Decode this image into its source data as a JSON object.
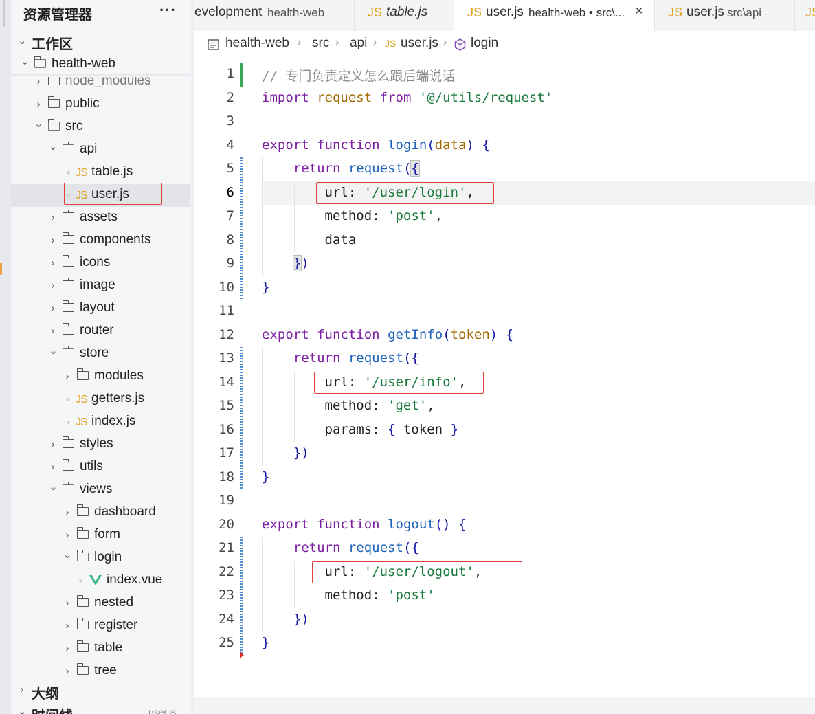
{
  "explorer": {
    "title": "资源管理器",
    "more": "···",
    "workspace_label": "工作区",
    "tree": [
      {
        "label": "health-web",
        "type": "folder-open",
        "depth": 0
      },
      {
        "label": "node_modules",
        "type": "folder",
        "depth": 1
      },
      {
        "label": "public",
        "type": "folder",
        "depth": 1
      },
      {
        "label": "src",
        "type": "folder-open",
        "depth": 1
      },
      {
        "label": "api",
        "type": "folder-open",
        "depth": 2
      },
      {
        "label": "table.js",
        "type": "js",
        "depth": 3
      },
      {
        "label": "user.js",
        "type": "js",
        "depth": 3,
        "active": true
      },
      {
        "label": "assets",
        "type": "folder",
        "depth": 2
      },
      {
        "label": "components",
        "type": "folder",
        "depth": 2
      },
      {
        "label": "icons",
        "type": "folder",
        "depth": 2
      },
      {
        "label": "image",
        "type": "folder",
        "depth": 2
      },
      {
        "label": "layout",
        "type": "folder",
        "depth": 2
      },
      {
        "label": "router",
        "type": "folder",
        "depth": 2
      },
      {
        "label": "store",
        "type": "folder-open",
        "depth": 2
      },
      {
        "label": "modules",
        "type": "folder",
        "depth": 3
      },
      {
        "label": "getters.js",
        "type": "js",
        "depth": 3
      },
      {
        "label": "index.js",
        "type": "js",
        "depth": 3
      },
      {
        "label": "styles",
        "type": "folder",
        "depth": 2
      },
      {
        "label": "utils",
        "type": "folder",
        "depth": 2
      },
      {
        "label": "views",
        "type": "folder-open",
        "depth": 2
      },
      {
        "label": "dashboard",
        "type": "folder",
        "depth": 3
      },
      {
        "label": "form",
        "type": "folder",
        "depth": 3
      },
      {
        "label": "login",
        "type": "folder-open",
        "depth": 3
      },
      {
        "label": "index.vue",
        "type": "vue",
        "depth": 4
      },
      {
        "label": "nested",
        "type": "folder",
        "depth": 3
      },
      {
        "label": "register",
        "type": "folder",
        "depth": 3
      },
      {
        "label": "table",
        "type": "folder",
        "depth": 3
      },
      {
        "label": "tree",
        "type": "folder",
        "depth": 3
      }
    ],
    "outline_label": "大纲",
    "timeline_label": "时间线",
    "timeline_hint": "user.js"
  },
  "tabs": [
    {
      "icon": "",
      "name": "evelopment",
      "path": "health-web",
      "active": false
    },
    {
      "icon": "JS",
      "name": "table.js",
      "path": "",
      "active": false,
      "italic": true
    },
    {
      "icon": "JS",
      "name": "user.js",
      "path": "health-web • src\\...",
      "active": true,
      "close": "×"
    },
    {
      "icon": "JS",
      "name": "user.js",
      "path": "src\\api",
      "active": false
    },
    {
      "icon": "JS",
      "name": "",
      "path": "",
      "active": false
    }
  ],
  "breadcrumb": [
    "health-web",
    "src",
    "api",
    "user.js",
    "login"
  ],
  "breadcrumb_icons": {
    "file": "JS"
  },
  "code": [
    {
      "n": "1",
      "t": [
        [
          "cm",
          "// 专门负责定义怎么跟后端说话"
        ]
      ]
    },
    {
      "n": "2",
      "t": [
        [
          "kw2",
          "import"
        ],
        [
          "",
          " "
        ],
        [
          "prm",
          "request"
        ],
        [
          "",
          " "
        ],
        [
          "kw2",
          "from"
        ],
        [
          "",
          " "
        ],
        [
          "str",
          "'@/utils/request'"
        ]
      ]
    },
    {
      "n": "3",
      "t": []
    },
    {
      "n": "4",
      "t": [
        [
          "kw2",
          "export"
        ],
        [
          "",
          " "
        ],
        [
          "kw2",
          "function"
        ],
        [
          "",
          " "
        ],
        [
          "fn",
          "login"
        ],
        [
          "br",
          "("
        ],
        [
          "prm",
          "data"
        ],
        [
          "br",
          ")"
        ],
        [
          "",
          " "
        ],
        [
          "br",
          "{"
        ]
      ]
    },
    {
      "n": "5",
      "t": [
        [
          "",
          "    "
        ],
        [
          "kw2",
          "return"
        ],
        [
          "",
          " "
        ],
        [
          "fn",
          "request"
        ],
        [
          "br",
          "("
        ],
        [
          "hl",
          "{"
        ]
      ]
    },
    {
      "n": "6",
      "t": [
        [
          "",
          "        "
        ],
        [
          "",
          "url: "
        ],
        [
          "str",
          "'/user/login'"
        ],
        [
          "",
          ","
        ]
      ]
    },
    {
      "n": "7",
      "t": [
        [
          "",
          "        "
        ],
        [
          "",
          "method: "
        ],
        [
          "str",
          "'post'"
        ],
        [
          "",
          ","
        ]
      ]
    },
    {
      "n": "8",
      "t": [
        [
          "",
          "        "
        ],
        [
          "",
          "data"
        ]
      ]
    },
    {
      "n": "9",
      "t": [
        [
          "",
          "    "
        ],
        [
          "hl",
          "}"
        ],
        [
          "br",
          ")"
        ]
      ]
    },
    {
      "n": "10",
      "t": [
        [
          "br",
          "}"
        ]
      ]
    },
    {
      "n": "11",
      "t": []
    },
    {
      "n": "12",
      "t": [
        [
          "kw2",
          "export"
        ],
        [
          "",
          " "
        ],
        [
          "kw2",
          "function"
        ],
        [
          "",
          " "
        ],
        [
          "fn",
          "getInfo"
        ],
        [
          "br",
          "("
        ],
        [
          "prm",
          "token"
        ],
        [
          "br",
          ")"
        ],
        [
          "",
          " "
        ],
        [
          "br",
          "{"
        ]
      ]
    },
    {
      "n": "13",
      "t": [
        [
          "",
          "    "
        ],
        [
          "kw2",
          "return"
        ],
        [
          "",
          " "
        ],
        [
          "fn",
          "request"
        ],
        [
          "br",
          "("
        ],
        [
          "br",
          "{"
        ]
      ]
    },
    {
      "n": "14",
      "t": [
        [
          "",
          "        "
        ],
        [
          "",
          "url: "
        ],
        [
          "str",
          "'/user/info'"
        ],
        [
          "",
          ","
        ]
      ]
    },
    {
      "n": "15",
      "t": [
        [
          "",
          "        "
        ],
        [
          "",
          "method: "
        ],
        [
          "str",
          "'get'"
        ],
        [
          "",
          ","
        ]
      ]
    },
    {
      "n": "16",
      "t": [
        [
          "",
          "        "
        ],
        [
          "",
          "params: "
        ],
        [
          "br",
          "{"
        ],
        [
          "",
          " token "
        ],
        [
          "br",
          "}"
        ]
      ]
    },
    {
      "n": "17",
      "t": [
        [
          "",
          "    "
        ],
        [
          "br",
          "})"
        ]
      ]
    },
    {
      "n": "18",
      "t": [
        [
          "br",
          "}"
        ]
      ]
    },
    {
      "n": "19",
      "t": []
    },
    {
      "n": "20",
      "t": [
        [
          "kw2",
          "export"
        ],
        [
          "",
          " "
        ],
        [
          "kw2",
          "function"
        ],
        [
          "",
          " "
        ],
        [
          "fn",
          "logout"
        ],
        [
          "br",
          "()"
        ],
        [
          "",
          " "
        ],
        [
          "br",
          "{"
        ]
      ]
    },
    {
      "n": "21",
      "t": [
        [
          "",
          "    "
        ],
        [
          "kw2",
          "return"
        ],
        [
          "",
          " "
        ],
        [
          "fn",
          "request"
        ],
        [
          "br",
          "("
        ],
        [
          "br",
          "{"
        ]
      ]
    },
    {
      "n": "22",
      "t": [
        [
          "",
          "        "
        ],
        [
          "",
          "url: "
        ],
        [
          "str",
          "'/user/logout'"
        ],
        [
          "",
          ","
        ]
      ]
    },
    {
      "n": "23",
      "t": [
        [
          "",
          "        "
        ],
        [
          "",
          "method: "
        ],
        [
          "str",
          "'post'"
        ]
      ]
    },
    {
      "n": "24",
      "t": [
        [
          "",
          "    "
        ],
        [
          "br",
          "})"
        ]
      ]
    },
    {
      "n": "25",
      "t": [
        [
          "br",
          "}"
        ]
      ]
    }
  ],
  "current_line": "6",
  "colors": {
    "accent": "#0033b3",
    "string": "#197a3b",
    "highlight_box": "#e0403a",
    "js_icon": "#e0a323"
  }
}
